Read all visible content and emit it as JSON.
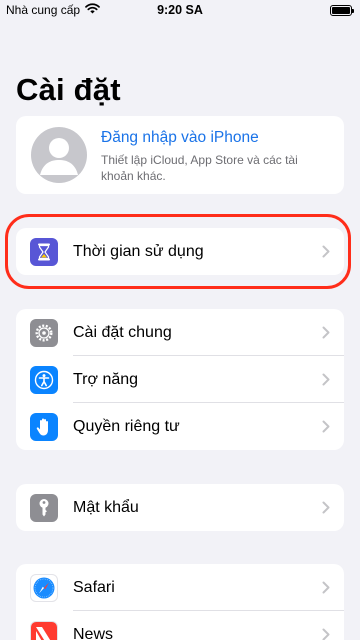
{
  "status_bar": {
    "carrier": "Nhà cung cấp",
    "time": "9:20 SA",
    "battery_level": 1.0
  },
  "page": {
    "title": "Cài đặt"
  },
  "profile": {
    "title": "Đăng nhập vào iPhone",
    "subtitle": "Thiết lập iCloud, App Store và các tài khoản khác."
  },
  "groups": {
    "screen_time": {
      "label": "Thời gian sử dụng",
      "icon": "hourglass-icon",
      "color": "#5856d6"
    },
    "general": [
      {
        "label": "Cài đặt chung",
        "icon": "gear-icon",
        "color": "#8e8e93"
      },
      {
        "label": "Trợ năng",
        "icon": "accessibility-icon",
        "color": "#0a84ff"
      },
      {
        "label": "Quyền riêng tư",
        "icon": "hand-icon",
        "color": "#0a84ff"
      }
    ],
    "passwords": {
      "label": "Mật khẩu",
      "icon": "key-icon",
      "color": "#8e8e93"
    },
    "apps": [
      {
        "label": "Safari",
        "icon": "compass-icon",
        "color": "#1a8cff"
      },
      {
        "label": "News",
        "icon": "news-icon",
        "color": "#ff3b30"
      }
    ]
  },
  "annotation": {
    "color": "#ff2d1a"
  }
}
